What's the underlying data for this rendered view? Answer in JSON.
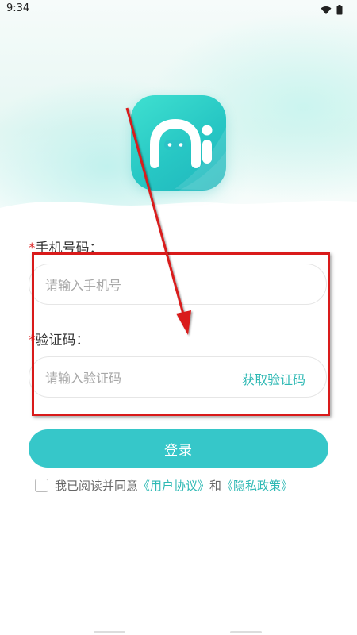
{
  "status_bar": {
    "time": "9:34",
    "icons": [
      "wifi-icon",
      "battery-icon"
    ]
  },
  "logo": {
    "text": "Ai",
    "icon": "app-logo"
  },
  "phone": {
    "label": "手机号码：",
    "required_mark": "*",
    "placeholder": "请输入手机号"
  },
  "code": {
    "label": "验证码：",
    "required_mark": "*",
    "placeholder": "请输入验证码",
    "get_code_label": "获取验证码"
  },
  "login": {
    "label": "登录"
  },
  "agreement": {
    "text_prefix": "我已阅读并同意",
    "user_agreement": "《用户协议》",
    "and": "和",
    "privacy_policy": "《隐私政策》",
    "checked": false
  },
  "colors": {
    "accent": "#36c7c9",
    "link": "#2fb9b4",
    "annotation": "#d91a1a",
    "required": "#e03030"
  }
}
